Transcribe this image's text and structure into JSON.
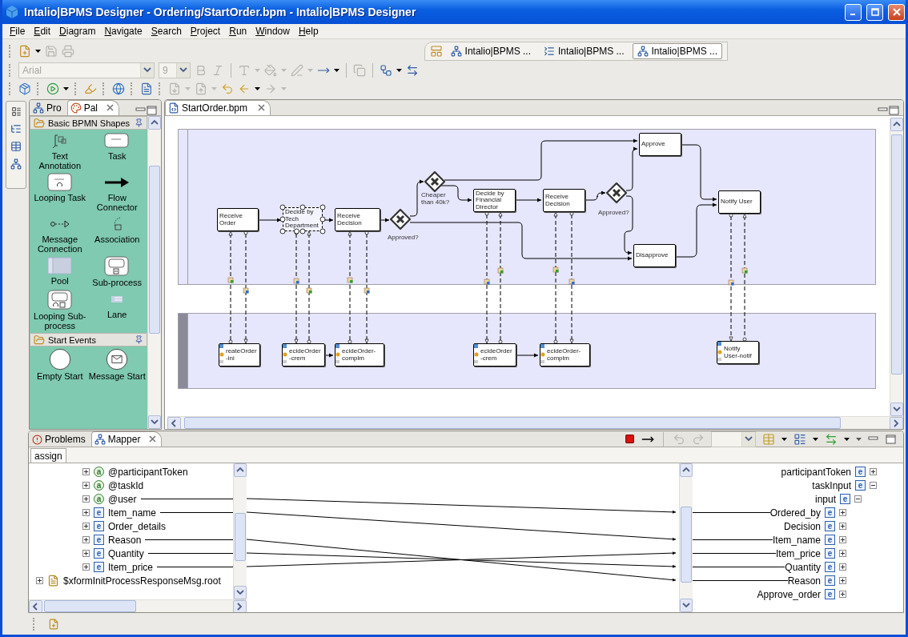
{
  "window": {
    "title": "Intalio|BPMS Designer - Ordering/StartOrder.bpm - Intalio|BPMS Designer"
  },
  "menu": [
    "File",
    "Edit",
    "Diagram",
    "Navigate",
    "Search",
    "Project",
    "Run",
    "Window",
    "Help"
  ],
  "toolbar": {
    "font_combo": {
      "value": "Arial",
      "disabled": true
    },
    "size_combo": {
      "value": "9",
      "disabled": true
    }
  },
  "perspectives": [
    {
      "label": "Intalio|BPMS ...",
      "selected": false
    },
    {
      "label": "Intalio|BPMS ...",
      "selected": false
    },
    {
      "label": "Intalio|BPMS ...",
      "selected": true
    }
  ],
  "left_panel": {
    "tabs": [
      {
        "label": "Pro",
        "selected": false
      },
      {
        "label": "Pal",
        "selected": true
      }
    ],
    "drawers": [
      {
        "title": "Basic BPMN Shapes",
        "items": [
          {
            "label": "Text Annotation",
            "kind": "annotation"
          },
          {
            "label": "Task",
            "kind": "task"
          },
          {
            "label": "Looping Task",
            "kind": "looping-task"
          },
          {
            "label": "Flow Connector",
            "kind": "flow"
          },
          {
            "label": "Message Connection",
            "kind": "message"
          },
          {
            "label": "Association",
            "kind": "association"
          },
          {
            "label": "Pool",
            "kind": "pool"
          },
          {
            "label": "Sub-process",
            "kind": "subprocess"
          },
          {
            "label": "Looping Sub-process",
            "kind": "looping-subprocess"
          },
          {
            "label": "Lane",
            "kind": "lane"
          }
        ]
      },
      {
        "title": "Start Events",
        "items": [
          {
            "label": "Empty Start",
            "kind": "empty-start"
          },
          {
            "label": "Message Start",
            "kind": "message-start"
          }
        ]
      }
    ]
  },
  "editor": {
    "tab": "StartOrder.bpm",
    "tasks": [
      {
        "label": "Receive Order",
        "selected": false
      },
      {
        "label": "Decide by Tech Department",
        "selected": true
      },
      {
        "label": "Receive Decision",
        "selected": false
      },
      {
        "label": "Decide by Financial Director",
        "selected": false
      },
      {
        "label": "Receive Decision",
        "selected": false
      },
      {
        "label": "Approve",
        "selected": false
      },
      {
        "label": "Disapprove",
        "selected": false
      },
      {
        "label": "Notify User",
        "selected": false
      }
    ],
    "gateways": [
      {
        "label": "Approved?"
      },
      {
        "label": "Cheaper than 40k?"
      },
      {
        "label": "Approved?"
      }
    ],
    "lane_tasks": [
      {
        "label": "reateOrder-ini"
      },
      {
        "label": "ecideOrder-crem"
      },
      {
        "label": "ecideOrder-complm"
      },
      {
        "label": "ecideOrder-crem"
      },
      {
        "label": "ecideOrder-complm"
      },
      {
        "label": "Notify User-notif"
      }
    ]
  },
  "bottom_panel": {
    "tabs": [
      {
        "label": "Problems",
        "selected": false
      },
      {
        "label": "Mapper",
        "selected": true
      }
    ],
    "subtab": "assign",
    "source_tree": [
      {
        "label": "@participantToken",
        "kind": "attribute",
        "badge": "a",
        "expanded": false
      },
      {
        "label": "@taskId",
        "kind": "attribute",
        "badge": "a",
        "expanded": false
      },
      {
        "label": "@user",
        "kind": "attribute",
        "badge": "a",
        "expanded": false
      },
      {
        "label": "Item_name",
        "kind": "element",
        "badge": "e",
        "expanded": false
      },
      {
        "label": "Order_details",
        "kind": "element",
        "badge": "e",
        "expanded": false
      },
      {
        "label": "Reason",
        "kind": "element",
        "badge": "e",
        "expanded": false
      },
      {
        "label": "Quantity",
        "kind": "element",
        "badge": "e",
        "expanded": false
      },
      {
        "label": "Item_price",
        "kind": "element",
        "badge": "e",
        "expanded": false
      },
      {
        "label": "$xformInitProcessResponseMsg.root",
        "kind": "message",
        "expanded": false
      }
    ],
    "target_tree": [
      {
        "label": "participantToken",
        "badge": "e",
        "expanded": false
      },
      {
        "label": "taskInput",
        "badge": "e",
        "expanded": true,
        "children": [
          {
            "label": "input",
            "badge": "e",
            "expanded": true,
            "children": [
              {
                "label": "Ordered_by",
                "badge": "e",
                "expanded": false
              },
              {
                "label": "Decision",
                "badge": "e",
                "expanded": false
              },
              {
                "label": "Item_name",
                "badge": "e",
                "expanded": false
              },
              {
                "label": "Item_price",
                "badge": "e",
                "expanded": false
              },
              {
                "label": "Quantity",
                "badge": "e",
                "expanded": false
              },
              {
                "label": "Reason",
                "badge": "e",
                "expanded": false
              },
              {
                "label": "Approve_order",
                "badge": "e",
                "expanded": false
              }
            ]
          }
        ]
      }
    ]
  }
}
